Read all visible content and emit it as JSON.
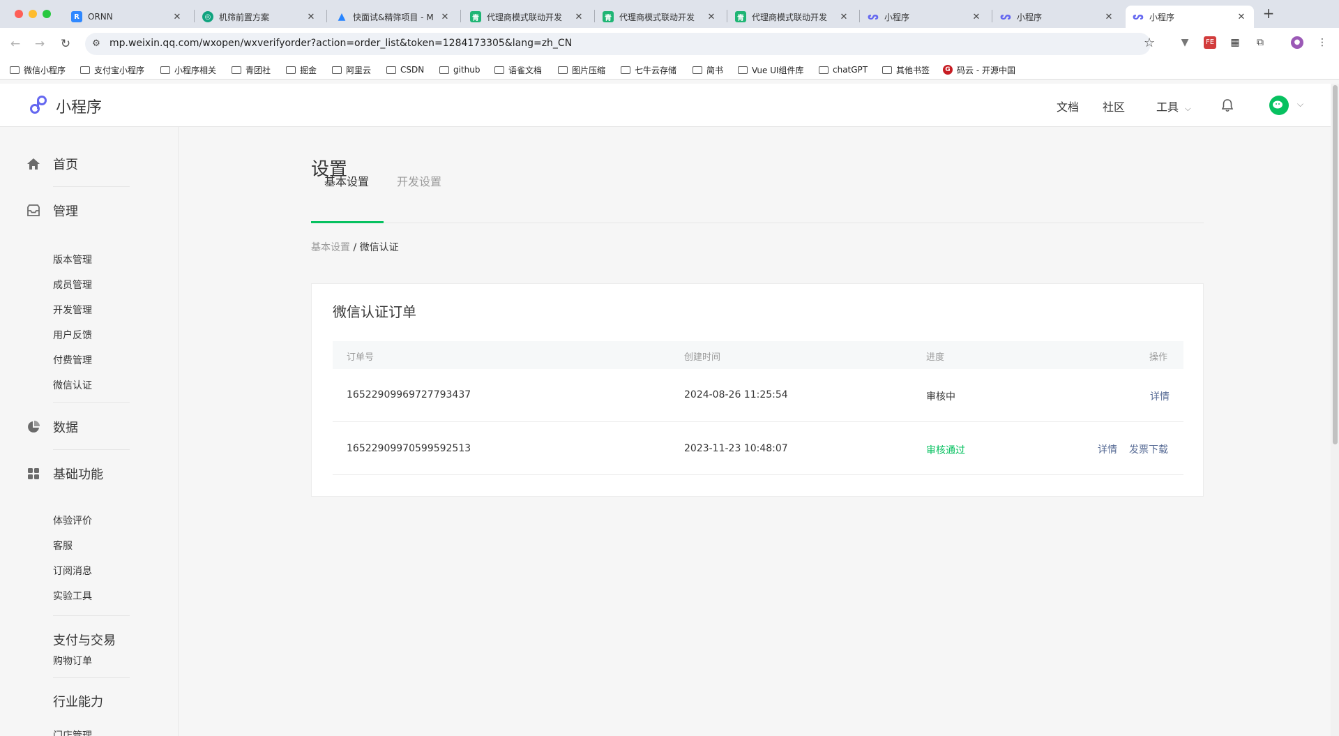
{
  "browser": {
    "tabs": [
      {
        "title": "ORNN",
        "favicon": "ornn-icon",
        "color": "#2f88ff"
      },
      {
        "title": "机筛前置方案",
        "favicon": "chatgpt-icon",
        "color": "#10a37f"
      },
      {
        "title": "快面试&精筛项目 - M",
        "favicon": "atlassian-icon",
        "color": "#2684ff"
      },
      {
        "title": "代理商模式联动开发",
        "favicon": "sheet-icon",
        "color": "#1fb574"
      },
      {
        "title": "代理商模式联动开发",
        "favicon": "sheet-icon",
        "color": "#1fb574"
      },
      {
        "title": "代理商模式联动开发",
        "favicon": "sheet-icon",
        "color": "#1fb574"
      },
      {
        "title": "小程序",
        "favicon": "miniprogram-icon",
        "color": "#6467f0"
      },
      {
        "title": "小程序",
        "favicon": "miniprogram-icon",
        "color": "#6467f0"
      },
      {
        "title": "小程序",
        "favicon": "miniprogram-icon",
        "color": "#6467f0"
      }
    ],
    "url": "mp.weixin.qq.com/wxopen/wxverifyorder?action=order_list&token=1284173305&lang=zh_CN",
    "bookmarks": [
      "微信小程序",
      "支付宝小程序",
      "小程序相关",
      "青团社",
      "掘金",
      "阿里云",
      "CSDN",
      "github",
      "语雀文档",
      "图片压缩",
      "七牛云存储",
      "简书",
      "Vue UI组件库",
      "chatGPT",
      "其他书签",
      "码云 - 开源中国"
    ]
  },
  "header": {
    "logo_text": "小程序",
    "nav": [
      "文档",
      "社区",
      "工具"
    ],
    "brand_color": "#07c160"
  },
  "sidebar": {
    "groups": [
      {
        "label": "首页",
        "icon": "home-icon"
      },
      {
        "label": "管理",
        "icon": "inbox-icon",
        "items": [
          "版本管理",
          "成员管理",
          "开发管理",
          "用户反馈",
          "付费管理",
          "微信认证"
        ]
      },
      {
        "label": "数据",
        "icon": "pie-chart-icon"
      },
      {
        "label": "基础功能",
        "icon": "grid-icon",
        "items": [
          "体验评价",
          "客服",
          "订阅消息",
          "实验工具"
        ]
      },
      {
        "label": "支付与交易",
        "items": [
          "购物订单"
        ]
      },
      {
        "label": "行业能力",
        "items": [
          "门店管理"
        ]
      }
    ]
  },
  "main": {
    "title": "设置",
    "tabs": [
      "基本设置",
      "开发设置"
    ],
    "breadcrumb": {
      "parent": "基本设置",
      "sep": " / ",
      "current": "微信认证"
    },
    "card_title": "微信认证订单",
    "columns": [
      "订单号",
      "创建时间",
      "进度",
      "操作"
    ],
    "rows": [
      {
        "order": "16522909969727793437",
        "time": "2024-08-26 11:25:54",
        "status": "审核中",
        "actions": [
          "详情"
        ]
      },
      {
        "order": "16522909970599592513",
        "time": "2023-11-23 10:48:07",
        "status": "审核通过",
        "actions": [
          "详情",
          "发票下载"
        ]
      }
    ]
  }
}
